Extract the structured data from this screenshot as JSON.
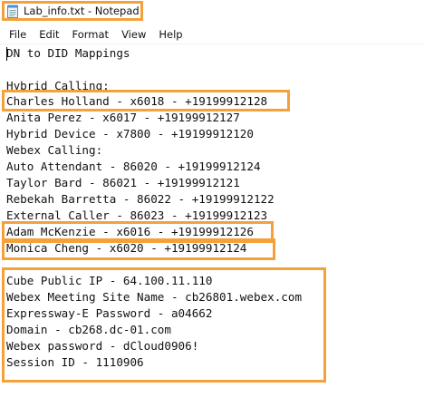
{
  "window": {
    "title": "Lab_info.txt - Notepad",
    "icon": "notepad-icon",
    "accent": "#f5a13a"
  },
  "menu": [
    "File",
    "Edit",
    "Format",
    "View",
    "Help"
  ],
  "lines": [
    "DN to DID Mappings",
    "",
    "Hybrid Calling:",
    "Charles Holland - x6018 - +19199912128",
    "Anita Perez - x6017 - +19199912127",
    "Hybrid Device - x7800 - +19199912120",
    "Webex Calling:",
    "Auto Attendant - 86020 - +19199912124",
    "Taylor Bard - 86021 - +19199912121",
    "Rebekah Barretta - 86022 - +19199912122",
    "External Caller - 86023 - +19199912123",
    "Adam McKenzie - x6016 - +19199912126",
    "Monica Cheng - x6020 - +19199912124",
    "",
    "Cube Public IP - 64.100.11.110",
    "Webex Meeting Site Name - cb26801.webex.com",
    "Expressway-E Password - a04662",
    "Domain - cb268.dc-01.com",
    "Webex password - dCloud0906!",
    "Session ID - 1110906"
  ]
}
